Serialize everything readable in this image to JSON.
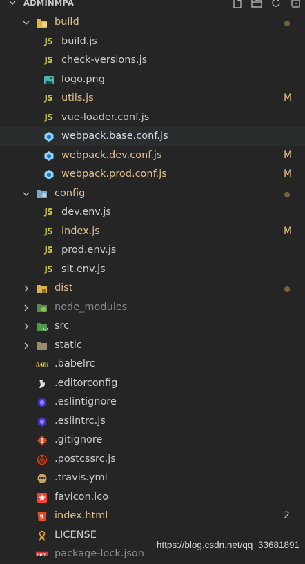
{
  "explorer": {
    "title": "ADMINMPA",
    "actions": [
      "new-file-icon",
      "new-folder-icon",
      "refresh-icon",
      "collapse-all-icon"
    ]
  },
  "tree": [
    {
      "label": "build",
      "type": "folder",
      "state": "open",
      "depth": 0,
      "icon": "build-folder-icon",
      "icon_color": "#e8b84a",
      "status": "dot",
      "status_text": "",
      "color": "mod"
    },
    {
      "label": "build.js",
      "type": "file",
      "depth": 1,
      "icon": "js-icon",
      "status": "",
      "status_text": "",
      "color": "def"
    },
    {
      "label": "check-versions.js",
      "type": "file",
      "depth": 1,
      "icon": "js-icon",
      "status": "",
      "status_text": "",
      "color": "def"
    },
    {
      "label": "logo.png",
      "type": "file",
      "depth": 1,
      "icon": "image-icon",
      "status": "",
      "status_text": "",
      "color": "def"
    },
    {
      "label": "utils.js",
      "type": "file",
      "depth": 1,
      "icon": "js-icon",
      "status": "M",
      "status_text": "M",
      "color": "mod"
    },
    {
      "label": "vue-loader.conf.js",
      "type": "file",
      "depth": 1,
      "icon": "js-icon",
      "status": "",
      "status_text": "",
      "color": "def"
    },
    {
      "label": "webpack.base.conf.js",
      "type": "file",
      "depth": 1,
      "icon": "webpack-icon",
      "status": "",
      "status_text": "",
      "color": "ws",
      "selected": true
    },
    {
      "label": "webpack.dev.conf.js",
      "type": "file",
      "depth": 1,
      "icon": "webpack-icon",
      "status": "M",
      "status_text": "M",
      "color": "mod"
    },
    {
      "label": "webpack.prod.conf.js",
      "type": "file",
      "depth": 1,
      "icon": "webpack-icon",
      "status": "M",
      "status_text": "M",
      "color": "mod"
    },
    {
      "label": "config",
      "type": "folder",
      "state": "open",
      "depth": 0,
      "icon": "config-folder-icon",
      "status": "dot",
      "status_text": "",
      "color": "mod"
    },
    {
      "label": "dev.env.js",
      "type": "file",
      "depth": 1,
      "icon": "js-icon",
      "status": "",
      "status_text": "",
      "color": "def"
    },
    {
      "label": "index.js",
      "type": "file",
      "depth": 1,
      "icon": "js-icon",
      "status": "M",
      "status_text": "M",
      "color": "mod"
    },
    {
      "label": "prod.env.js",
      "type": "file",
      "depth": 1,
      "icon": "js-icon",
      "status": "",
      "status_text": "",
      "color": "def"
    },
    {
      "label": "sit.env.js",
      "type": "file",
      "depth": 1,
      "icon": "js-icon",
      "status": "",
      "status_text": "",
      "color": "def"
    },
    {
      "label": "dist",
      "type": "folder",
      "state": "closed",
      "depth": 0,
      "icon": "dist-folder-icon",
      "status": "dot",
      "status_text": "",
      "color": "mod"
    },
    {
      "label": "node_modules",
      "type": "folder",
      "state": "closed",
      "depth": 0,
      "icon": "node-folder-icon",
      "status": "",
      "status_text": "",
      "color": "dim"
    },
    {
      "label": "src",
      "type": "folder",
      "state": "closed",
      "depth": 0,
      "icon": "src-folder-icon",
      "status": "",
      "status_text": "",
      "color": "def"
    },
    {
      "label": "static",
      "type": "folder",
      "state": "closed",
      "depth": 0,
      "icon": "folder-icon",
      "status": "",
      "status_text": "",
      "color": "def"
    },
    {
      "label": ".babelrc",
      "type": "file",
      "depth": 0,
      "icon": "babel-icon",
      "status": "",
      "status_text": "",
      "color": "def"
    },
    {
      "label": ".editorconfig",
      "type": "file",
      "depth": 0,
      "icon": "editorconfig-icon",
      "status": "",
      "status_text": "",
      "color": "def"
    },
    {
      "label": ".eslintignore",
      "type": "file",
      "depth": 0,
      "icon": "eslint-icon",
      "status": "",
      "status_text": "",
      "color": "def"
    },
    {
      "label": ".eslintrc.js",
      "type": "file",
      "depth": 0,
      "icon": "eslint-icon",
      "status": "",
      "status_text": "",
      "color": "def"
    },
    {
      "label": ".gitignore",
      "type": "file",
      "depth": 0,
      "icon": "git-icon",
      "status": "",
      "status_text": "",
      "color": "def"
    },
    {
      "label": ".postcssrc.js",
      "type": "file",
      "depth": 0,
      "icon": "postcss-icon",
      "status": "",
      "status_text": "",
      "color": "def"
    },
    {
      "label": ".travis.yml",
      "type": "file",
      "depth": 0,
      "icon": "travis-icon",
      "status": "",
      "status_text": "",
      "color": "def"
    },
    {
      "label": "favicon.ico",
      "type": "file",
      "depth": 0,
      "icon": "favicon-icon",
      "status": "",
      "status_text": "",
      "color": "def"
    },
    {
      "label": "index.html",
      "type": "file",
      "depth": 0,
      "icon": "html-icon",
      "status": "2",
      "status_text": "2",
      "color": "mod"
    },
    {
      "label": "LICENSE",
      "type": "file",
      "depth": 0,
      "icon": "license-icon",
      "status": "",
      "status_text": "",
      "color": "def"
    },
    {
      "label": "package-lock.json",
      "type": "file",
      "depth": 0,
      "icon": "npm-icon",
      "status": "",
      "status_text": "",
      "color": "dim"
    }
  ],
  "colors": {
    "background": "#252526",
    "selected_row": "#2a2d2e",
    "modified": "#e2c08d",
    "dimmed": "#8c8c8c",
    "js": "#cbcb41",
    "dot": "#73643a"
  },
  "watermark": "https://blog.csdn.net/qq_33681891"
}
